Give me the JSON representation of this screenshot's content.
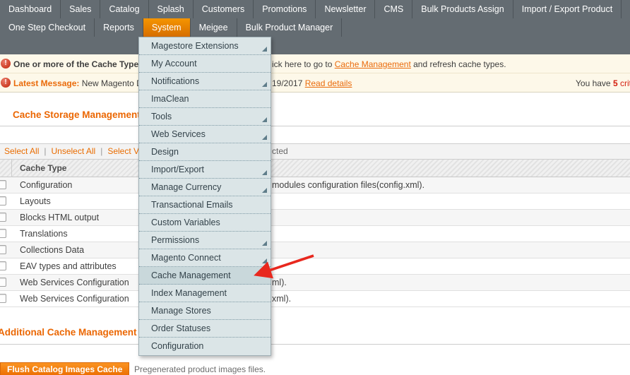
{
  "colors": {
    "nav_bg": "#646c72",
    "active_tab_orange": "#f08000",
    "accent_orange": "#eb6703",
    "link_orange": "#ea6b0b",
    "error_red": "#c02408",
    "critical_red": "#d41f0f",
    "annotation_arrow_red": "#e8281e",
    "menu_bg": "#dbe5e7",
    "message_bg": "#fdf8e9"
  },
  "nav": {
    "row1": [
      {
        "label": "Dashboard"
      },
      {
        "label": "Sales"
      },
      {
        "label": "Catalog"
      },
      {
        "label": "Splash"
      },
      {
        "label": "Customers"
      },
      {
        "label": "Promotions"
      },
      {
        "label": "Newsletter"
      },
      {
        "label": "CMS"
      },
      {
        "label": "Bulk Products Assign"
      },
      {
        "label": "Import / Export Product"
      }
    ],
    "row2": [
      {
        "label": "One Step Checkout"
      },
      {
        "label": "Reports"
      },
      {
        "label": "System",
        "active": true
      },
      {
        "label": "Meigee"
      },
      {
        "label": "Bulk Product Manager"
      }
    ]
  },
  "menu": {
    "items": [
      {
        "label": "Magestore Extensions",
        "has_submenu": true
      },
      {
        "label": "My Account",
        "has_submenu": false
      },
      {
        "label": "Notifications",
        "has_submenu": true
      },
      {
        "label": "ImaClean",
        "has_submenu": false
      },
      {
        "label": "Tools",
        "has_submenu": true
      },
      {
        "label": "Web Services",
        "has_submenu": true
      },
      {
        "label": "Design",
        "has_submenu": false
      },
      {
        "label": "Import/Export",
        "has_submenu": true
      },
      {
        "label": "Manage Currency",
        "has_submenu": true
      },
      {
        "label": "Transactional Emails",
        "has_submenu": false
      },
      {
        "label": "Custom Variables",
        "has_submenu": false
      },
      {
        "label": "Permissions",
        "has_submenu": true
      },
      {
        "label": "Magento Connect",
        "has_submenu": true
      },
      {
        "label": "Cache Management",
        "has_submenu": false,
        "highlighted": true
      },
      {
        "label": "Index Management",
        "has_submenu": false
      },
      {
        "label": "Manage Stores",
        "has_submenu": false
      },
      {
        "label": "Order Statuses",
        "has_submenu": false
      },
      {
        "label": "Configuration",
        "has_submenu": false
      }
    ]
  },
  "messages": {
    "cache_notice": {
      "left_fragment": "One or more of the Cache Types are",
      "right_pre": "ick here to go to ",
      "link": "Cache Management",
      "right_post": " and refresh cache types."
    },
    "latest_message": {
      "label": "Latest Message:",
      "left_fragment": " New Magento DevB",
      "right_pre": "19/2017 ",
      "link": "Read details",
      "far_right_pre": "You have ",
      "count": "5",
      "far_right_post": " crit"
    }
  },
  "page": {
    "title": "Cache Storage Management"
  },
  "toolbar": {
    "select_all": "Select All",
    "unselect_all": "Unselect All",
    "select_visible": "Select Visible",
    "separator": "|",
    "right_fragment": "cted"
  },
  "table": {
    "header_label": "Cache Type",
    "rows": [
      {
        "name": "Configuration",
        "desc_fragment": "modules configuration files(config.xml)."
      },
      {
        "name": "Layouts",
        "desc_fragment": ""
      },
      {
        "name": "Blocks HTML output",
        "desc_fragment": ""
      },
      {
        "name": "Translations",
        "desc_fragment": ""
      },
      {
        "name": "Collections Data",
        "desc_fragment": ""
      },
      {
        "name": "EAV types and attributes",
        "desc_fragment": ""
      },
      {
        "name": "Web Services Configuration",
        "desc_fragment": "ml)."
      },
      {
        "name": "Web Services Configuration",
        "desc_fragment": "xml)."
      }
    ]
  },
  "additional": {
    "title": "Additional Cache Management",
    "flush_button": "Flush Catalog Images Cache",
    "flush_desc": "Pregenerated product images files."
  }
}
